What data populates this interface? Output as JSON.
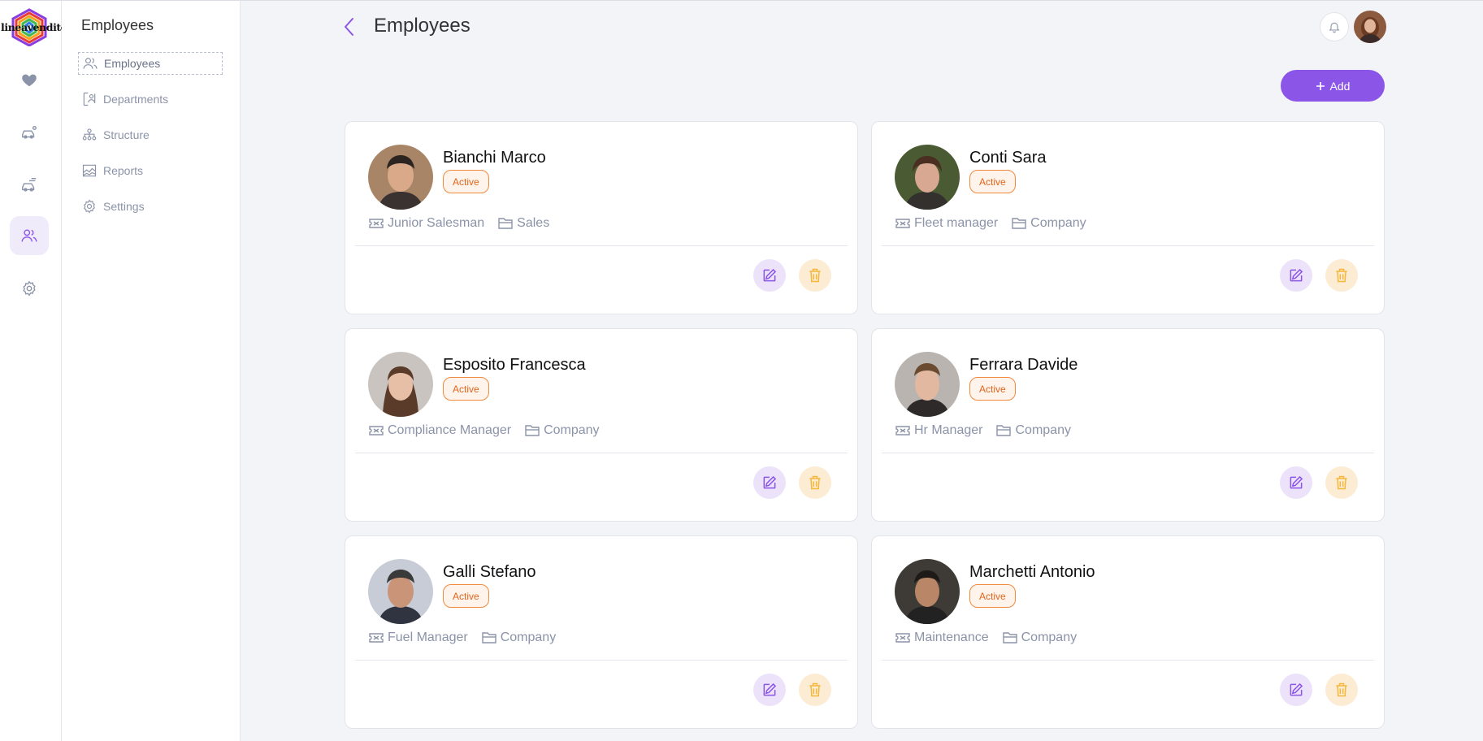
{
  "brand": {
    "logo_text": "lineavendite"
  },
  "header": {
    "title": "Employees",
    "add_label": "Add"
  },
  "subnav": {
    "title": "Employees",
    "items": [
      {
        "label": "Employees",
        "icon": "users-icon"
      },
      {
        "label": "Departments",
        "icon": "departments-icon"
      },
      {
        "label": "Structure",
        "icon": "structure-icon"
      },
      {
        "label": "Reports",
        "icon": "reports-icon"
      },
      {
        "label": "Settings",
        "icon": "gear-icon"
      }
    ]
  },
  "rail": [
    "heart-icon",
    "car-icon",
    "car-speed-icon",
    "users-icon",
    "gear-icon"
  ],
  "colors": {
    "accent": "#8b55e8",
    "status": "#e0651c",
    "delete": "#f5b73b"
  },
  "employees": [
    {
      "name": "Bianchi Marco",
      "status": "Active",
      "role": "Junior Salesman",
      "department": "Sales"
    },
    {
      "name": "Conti Sara",
      "status": "Active",
      "role": "Fleet manager",
      "department": "Company"
    },
    {
      "name": "Esposito Francesca",
      "status": "Active",
      "role": "Compliance Manager",
      "department": "Company"
    },
    {
      "name": "Ferrara Davide",
      "status": "Active",
      "role": "Hr Manager",
      "department": "Company"
    },
    {
      "name": "Galli Stefano",
      "status": "Active",
      "role": "Fuel Manager",
      "department": "Company"
    },
    {
      "name": "Marchetti Antonio",
      "status": "Active",
      "role": "Maintenance",
      "department": "Company"
    }
  ]
}
